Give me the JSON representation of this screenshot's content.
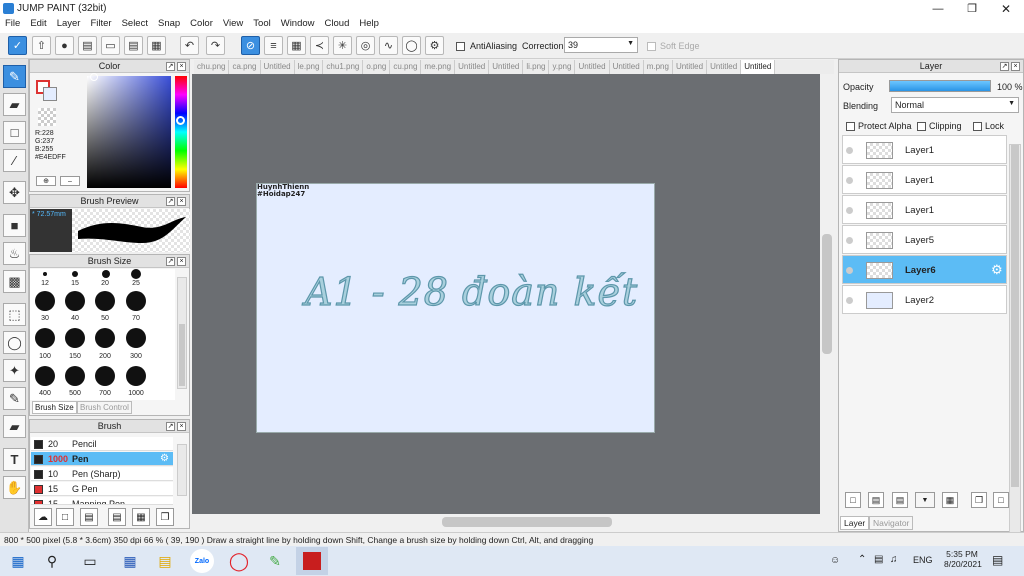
{
  "app": {
    "title": "JUMP PAINT (32bit)"
  },
  "menu": [
    "File",
    "Edit",
    "Layer",
    "Filter",
    "Select",
    "Snap",
    "Color",
    "View",
    "Tool",
    "Window",
    "Cloud",
    "Help"
  ],
  "toolbar": {
    "antialiasing_label": "AntiAliasing",
    "correction_label": "Correction",
    "correction_value": "39",
    "soft_edge_label": "Soft Edge"
  },
  "color_panel": {
    "title": "Color",
    "r": "R:228",
    "g": "G:237",
    "b": "B:255",
    "hex": "#E4EDFF"
  },
  "brush_preview": {
    "title": "Brush Preview",
    "size": "* 72.57mm"
  },
  "brush_size": {
    "title": "Brush Size",
    "labels": [
      "12",
      "15",
      "20",
      "25",
      "30",
      "40",
      "50",
      "70",
      "100",
      "150",
      "200",
      "300",
      "400",
      "500",
      "700",
      "1000"
    ],
    "tab_active": "Brush Size",
    "tab_inactive": "Brush Control"
  },
  "brush_panel": {
    "title": "Brush",
    "items": [
      {
        "size": "20",
        "name": "Pencil",
        "color": "#222222"
      },
      {
        "size": "1000",
        "name": "Pen",
        "color": "#222222"
      },
      {
        "size": "10",
        "name": "Pen (Sharp)",
        "color": "#222222"
      },
      {
        "size": "15",
        "name": "G Pen",
        "color": "#e03030"
      },
      {
        "size": "15",
        "name": "Mapping Pen",
        "color": "#e03030"
      }
    ]
  },
  "doc_tabs": [
    "chu.png",
    "ca.png",
    "Untitled",
    "le.png",
    "chu1.png",
    "o.png",
    "cu.png",
    "me.png",
    "Untitled",
    "Untitled",
    "li.png",
    "y.png",
    "Untitled",
    "Untitled",
    "m.png",
    "Untitled",
    "Untitled",
    "Untitled"
  ],
  "canvas": {
    "watermark_line1": "HuynhThienn",
    "watermark_line2": "#Hoidap247",
    "art_text": "A1 - 28 đoàn kết"
  },
  "layer_panel": {
    "title": "Layer",
    "opacity_label": "Opacity",
    "opacity_value": "100 %",
    "opacity": 1.0,
    "blending_label": "Blending",
    "blending_value": "Normal",
    "protect_alpha": "Protect Alpha",
    "clipping": "Clipping",
    "lock": "Lock",
    "layers": [
      "Layer1",
      "Layer1",
      "Layer1",
      "Layer5",
      "Layer6",
      "Layer2"
    ],
    "tabs": [
      "Layer",
      "Navigator"
    ]
  },
  "status": {
    "text": "800 * 500 pixel   (5.8 * 3.6cm)   350 dpi   66 %   ( 39, 190 )   Draw a straight line by holding down Shift, Change a brush size by holding down Ctrl, Alt, and dragging"
  },
  "taskbar": {
    "lang": "ENG",
    "time": "5:35 PM",
    "date": "8/20/2021",
    "zalo": "Zalo"
  }
}
